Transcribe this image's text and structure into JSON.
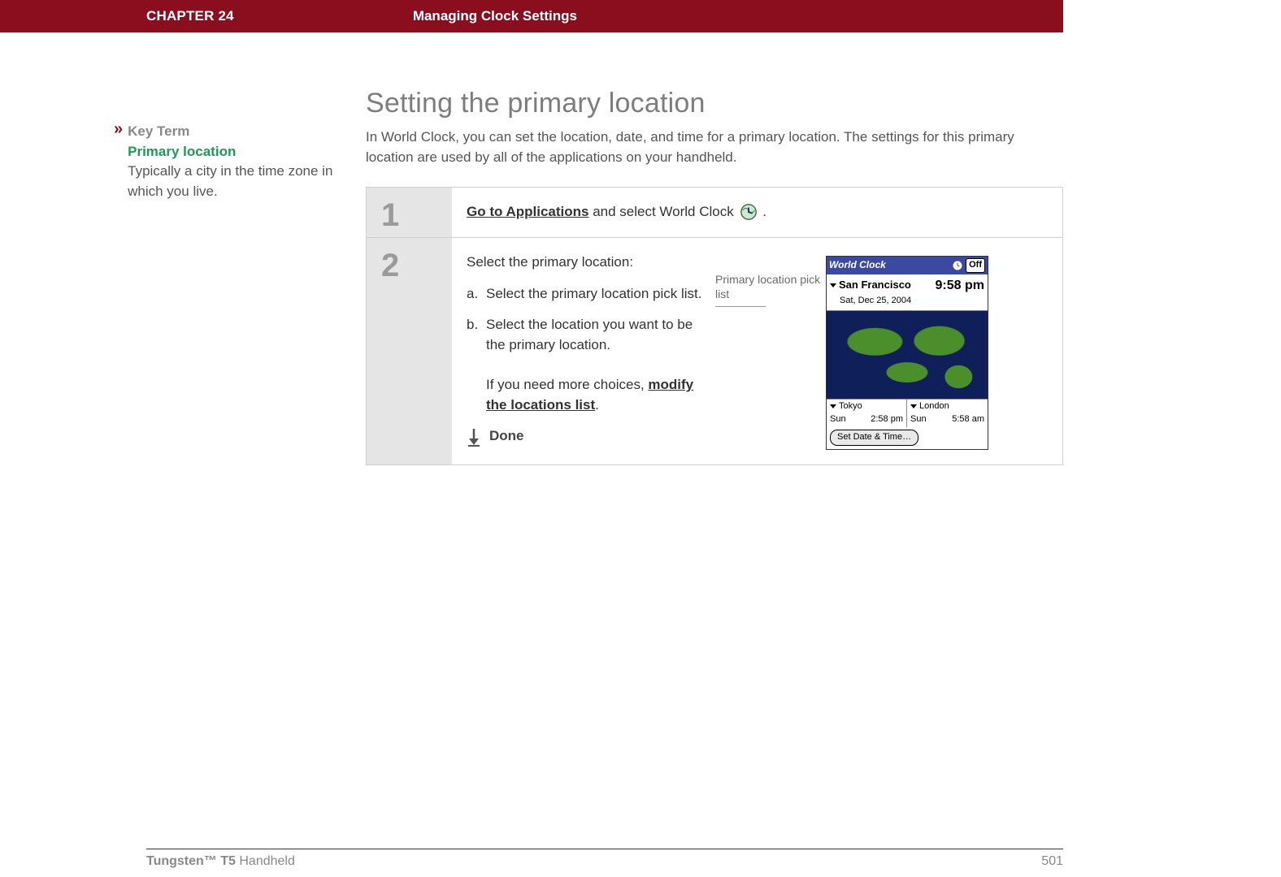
{
  "header": {
    "chapter_label": "CHAPTER 24",
    "chapter_title": "Managing Clock Settings"
  },
  "sidebar": {
    "key_term_heading": "Key Term",
    "key_term_name": "Primary location",
    "key_term_definition": "Typically a city in the time zone in which you live."
  },
  "main": {
    "section_title": "Setting the primary location",
    "section_intro": "In World Clock, you can set the location, date, and time for a primary location. The settings for this primary location are used by all of the applications on your handheld.",
    "step1": {
      "number": "1",
      "link_text": "Go to Applications",
      "after_link": " and select World Clock ",
      "period": " ."
    },
    "step2": {
      "number": "2",
      "lead": "Select the primary location:",
      "a_marker": "a.",
      "a_text": "Select the primary location pick list.",
      "b_marker": "b.",
      "b_text": "Select the location you want to be the primary location.",
      "extra_lead": "If you need more choices, ",
      "extra_link": "modify the locations list",
      "extra_period": ".",
      "done_label": "Done",
      "callout_label": "Primary location pick list"
    }
  },
  "device": {
    "title": "World Clock",
    "off_badge": "Off",
    "primary_city": "San Francisco",
    "primary_date": "Sat, Dec 25, 2004",
    "primary_time": "9:58 pm",
    "city2": "Tokyo",
    "city2_day": "Sun",
    "city2_time": "2:58 pm",
    "city3": "London",
    "city3_day": "Sun",
    "city3_time": "5:58 am",
    "set_button": "Set Date & Time…"
  },
  "footer": {
    "brand_bold": "Tungsten™ T5",
    "brand_light": " Handheld",
    "page_number": "501"
  }
}
